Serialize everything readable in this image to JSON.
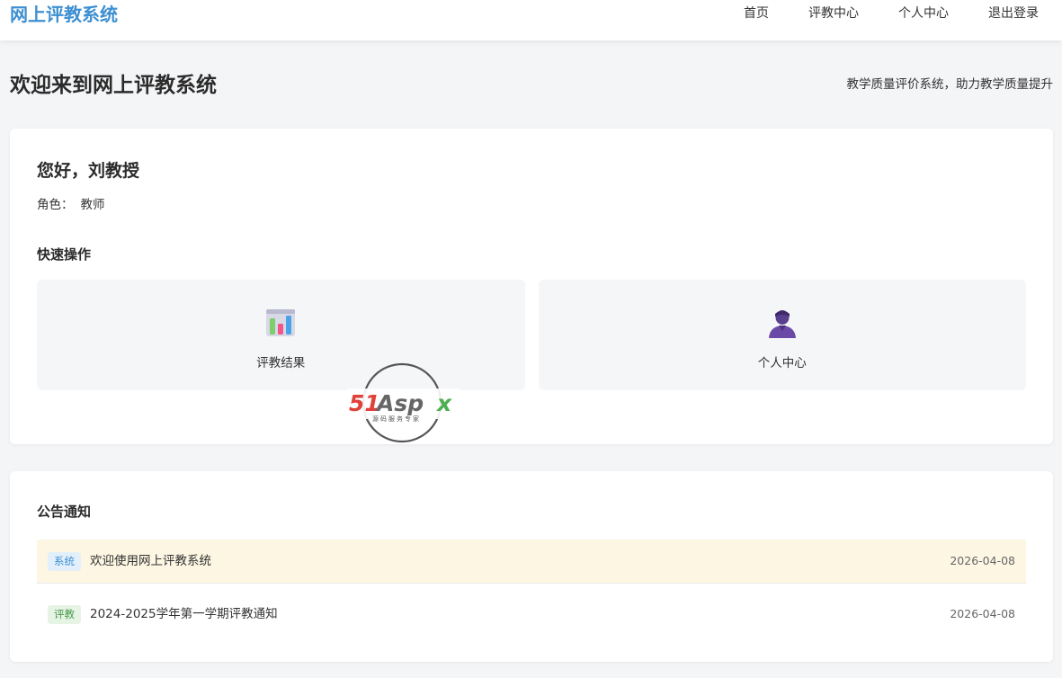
{
  "header": {
    "brand": "网上评教系统",
    "nav": [
      "首页",
      "评教中心",
      "个人中心",
      "退出登录"
    ]
  },
  "page": {
    "title": "欢迎来到网上评教系统",
    "subtitle": "教学质量评价系统，助力教学质量提升"
  },
  "welcome": {
    "greeting": "您好，刘教授",
    "role_label": "角色：",
    "role_value": "教师",
    "quick_title": "快速操作",
    "quick_actions": [
      {
        "label": "评教结果",
        "icon": "bar-chart-icon"
      },
      {
        "label": "个人中心",
        "icon": "user-icon"
      }
    ]
  },
  "notices": {
    "title": "公告通知",
    "items": [
      {
        "tag": "系统",
        "tag_bg": "#e3f0fb",
        "tag_color": "#3d8fd1",
        "text": "欢迎使用网上评教系统",
        "date": "2026-04-08"
      },
      {
        "tag": "评教",
        "tag_bg": "#e6f4e6",
        "tag_color": "#4a9a4a",
        "text": "2024-2025学年第一学期评教通知",
        "date": "2026-04-08"
      }
    ]
  },
  "watermark": {
    "logo_text": "51Aspx",
    "logo_sub": "源码服务专家"
  },
  "colors": {
    "brand": "#3d8fd1",
    "highlight_row": "#fdf6e3",
    "background": "#f4f5f7"
  }
}
